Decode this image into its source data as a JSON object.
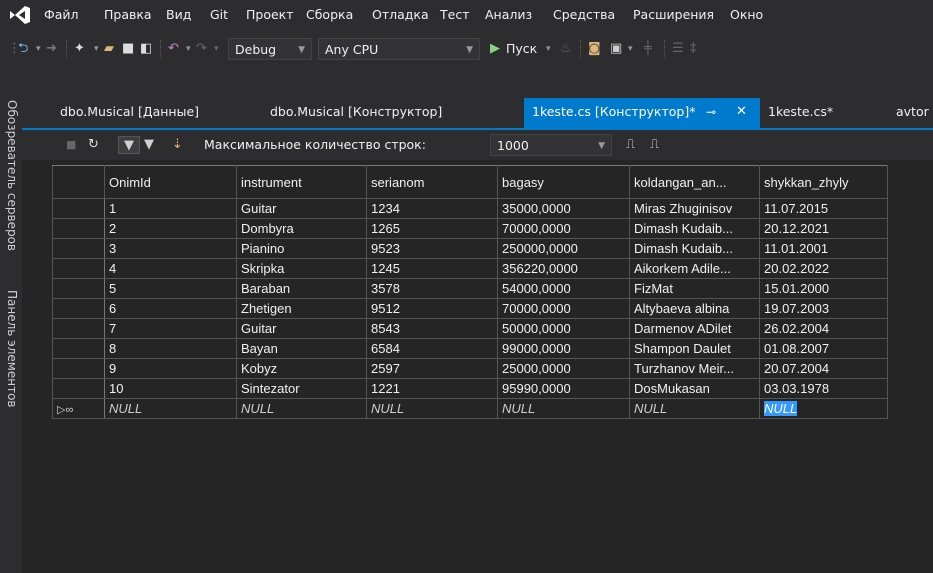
{
  "menu": {
    "items": [
      "Файл",
      "Правка",
      "Вид",
      "Git",
      "Проект",
      "Сборка",
      "Отладка",
      "Тест",
      "Анализ",
      "Средства",
      "Расширения",
      "Окно"
    ]
  },
  "toolbar": {
    "config_combo": "Debug",
    "platform_combo": "Any CPU",
    "run_label": "Пуск"
  },
  "sidebar": {
    "server_explorer": "Обозреватель серверов",
    "toolbox": "Панель элементов"
  },
  "tabs": [
    {
      "label": "dbo.Musical [Данные]"
    },
    {
      "label": "dbo.Musical [Конструктор]"
    },
    {
      "label": "1keste.cs [Конструктор]*"
    },
    {
      "label": "1keste.cs*"
    },
    {
      "label": "avtor"
    }
  ],
  "query_toolbar": {
    "max_rows_label": "Максимальное количество строк:",
    "max_rows_value": "1000"
  },
  "grid": {
    "columns": [
      "OnimId",
      "instrument",
      "serianom",
      "bagasy",
      "koldangan_an...",
      "shykkan_zhyly"
    ],
    "rows": [
      [
        "1",
        "Guitar",
        "1234",
        "35000,0000",
        "Miras Zhuginisov",
        "11.07.2015"
      ],
      [
        "2",
        "Dombyra",
        "1265",
        "70000,0000",
        "Dimash Kudaib...",
        "20.12.2021"
      ],
      [
        "3",
        "Pianino",
        "9523",
        "250000,0000",
        "Dimash Kudaib...",
        "11.01.2001"
      ],
      [
        "4",
        "Skripka",
        "1245",
        "356220,0000",
        "Aikorkem Adile...",
        "20.02.2022"
      ],
      [
        "5",
        "Baraban",
        "3578",
        "54000,0000",
        "FizMat",
        "15.01.2000"
      ],
      [
        "6",
        "Zhetigen",
        "9512",
        "70000,0000",
        "Altybaeva albina",
        "19.07.2003"
      ],
      [
        "7",
        "Guitar",
        "8543",
        "50000,0000",
        "Darmenov ADilet",
        "26.02.2004"
      ],
      [
        "8",
        "Bayan",
        "6584",
        "99000,0000",
        "Shampon Daulet",
        "01.08.2007"
      ],
      [
        "9",
        "Kobyz",
        "2597",
        "25000,0000",
        "Turzhanov Meir...",
        "20.07.2004"
      ],
      [
        "10",
        "Sintezator",
        "1221",
        "95990,0000",
        "DosMukasan",
        "03.03.1978"
      ]
    ],
    "new_row": [
      "NULL",
      "NULL",
      "NULL",
      "NULL",
      "NULL",
      "NULL"
    ]
  },
  "colors": {
    "accent": "#007acc",
    "selection": "#3399ff",
    "background": "#2d2d30",
    "grid_bg": "#252526"
  }
}
